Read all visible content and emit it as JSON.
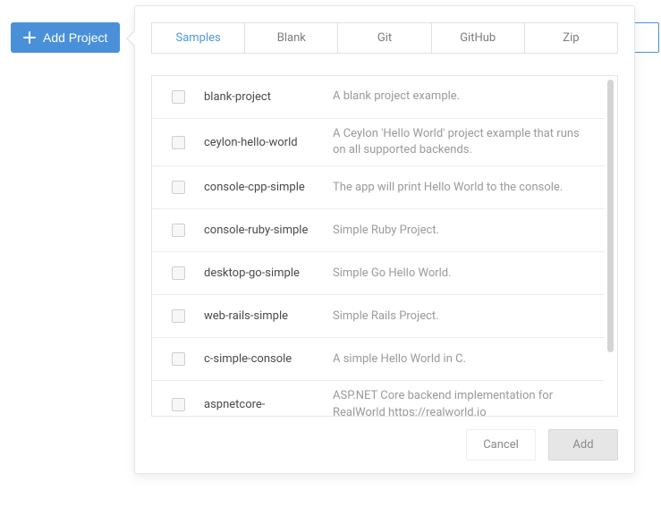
{
  "addProject": {
    "label": "Add Project"
  },
  "tabs": [
    {
      "label": "Samples",
      "active": true
    },
    {
      "label": "Blank",
      "active": false
    },
    {
      "label": "Git",
      "active": false
    },
    {
      "label": "GitHub",
      "active": false
    },
    {
      "label": "Zip",
      "active": false
    }
  ],
  "samples": [
    {
      "name": "blank-project",
      "description": "A blank project example."
    },
    {
      "name": "ceylon-hello-world",
      "description": "A Ceylon 'Hello World' project example that runs on all supported backends."
    },
    {
      "name": "console-cpp-simple",
      "description": "The app will print Hello World to the console."
    },
    {
      "name": "console-ruby-simple",
      "description": "Simple Ruby Project."
    },
    {
      "name": "desktop-go-simple",
      "description": "Simple Go Hello World."
    },
    {
      "name": "web-rails-simple",
      "description": "Simple Rails Project."
    },
    {
      "name": "c-simple-console",
      "description": "A simple Hello World in C."
    },
    {
      "name": "aspnetcore-",
      "description": "ASP.NET Core backend implementation for RealWorld https://realworld.io"
    }
  ],
  "footer": {
    "cancel": "Cancel",
    "add": "Add"
  }
}
